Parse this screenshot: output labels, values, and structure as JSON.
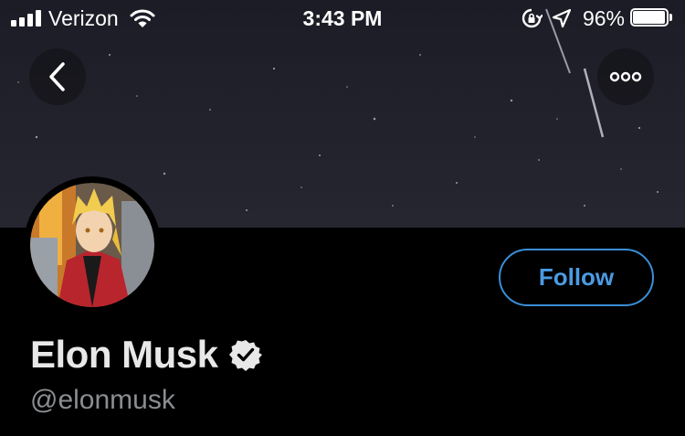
{
  "status_bar": {
    "carrier": "Verizon",
    "time": "3:43 PM",
    "battery_percent": "96%",
    "battery_level": 0.96,
    "signal_bars": 4,
    "icons": [
      "signal-icon",
      "wifi-icon",
      "rotation-lock-icon",
      "location-arrow-icon",
      "battery-icon"
    ]
  },
  "header": {
    "back_icon": "chevron-left-icon",
    "more_icon": "more-dots-icon"
  },
  "profile": {
    "display_name": "Elon Musk",
    "handle": "@elonmusk",
    "verified": true,
    "follow_label": "Follow"
  },
  "colors": {
    "accent": "#4a9be3",
    "background": "#000000",
    "name": "#e8e8e8",
    "handle": "#8a8d91"
  }
}
